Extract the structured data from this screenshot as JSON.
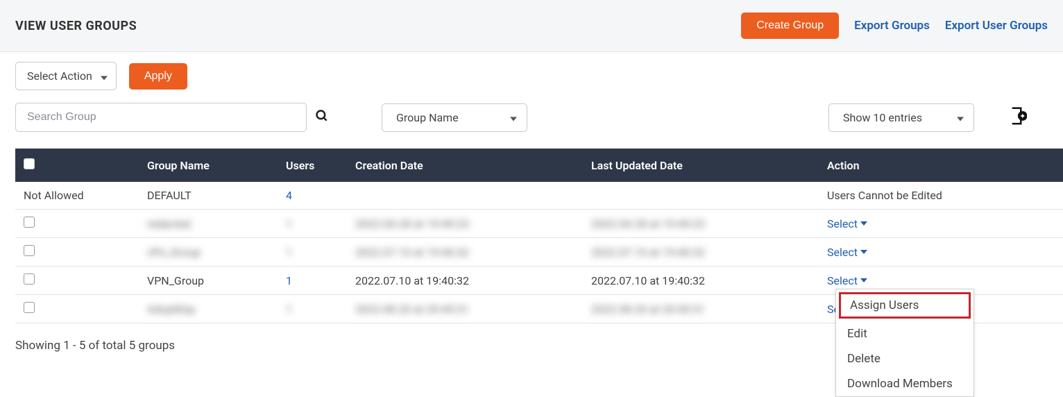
{
  "header": {
    "title": "VIEW USER GROUPS",
    "create_btn": "Create Group",
    "export_groups": "Export Groups",
    "export_user_groups": "Export User Groups"
  },
  "toolbar": {
    "select_action": "Select Action",
    "apply": "Apply"
  },
  "filter": {
    "search_placeholder": "Search Group",
    "filter_by": "Group Name",
    "show_entries": "Show 10 entries"
  },
  "table": {
    "headers": {
      "name": "Group Name",
      "users": "Users",
      "created": "Creation Date",
      "updated": "Last Updated Date",
      "action": "Action"
    },
    "rows": [
      {
        "check": "Not Allowed",
        "name": "DEFAULT",
        "users": "4",
        "created": "",
        "updated": "",
        "action": "Users Cannot be Edited",
        "action_type": "text",
        "blurred": false
      },
      {
        "check": "checkbox",
        "name": "redacted",
        "users": "1",
        "created": "2022.04.28 at 19:49:23",
        "updated": "2022.04.28 at 19:49:23",
        "action": "Select",
        "action_type": "select",
        "blurred": true
      },
      {
        "check": "checkbox",
        "name": "vPn_Group",
        "users": "1",
        "created": "2022.07.10 at 19:40:32",
        "updated": "2022.07.10 at 19:40:32",
        "action": "Select",
        "action_type": "select",
        "blurred": true
      },
      {
        "check": "checkbox",
        "name": "VPN_Group",
        "users": "1",
        "created": "2022.07.10 at 19:40:32",
        "updated": "2022.07.10 at 19:40:32",
        "action": "Select",
        "action_type": "select",
        "blurred": false,
        "menu_open": true
      },
      {
        "check": "checkbox",
        "name": "AdoptDay",
        "users": "1",
        "created": "2022.08.20 at 20:45:31",
        "updated": "2022.08.20 at 20:45:31",
        "action": "Select",
        "action_type": "select",
        "blurred": true
      }
    ],
    "select_label": "Select"
  },
  "dropdown": {
    "assign": "Assign Users",
    "edit": "Edit",
    "delete": "Delete",
    "download": "Download Members"
  },
  "footer": "Showing 1 - 5 of total 5 groups"
}
